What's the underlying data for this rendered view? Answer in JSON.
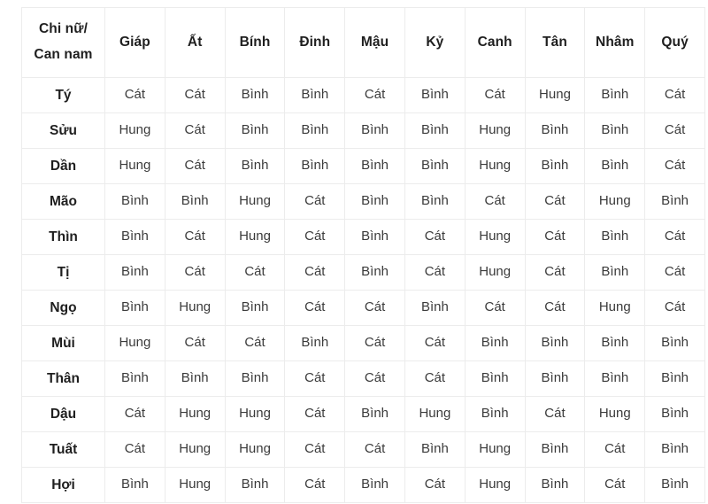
{
  "table": {
    "corner_header": "Chi nữ/ Can nam",
    "column_headers": [
      "Giáp",
      "Ất",
      "Bính",
      "Đinh",
      "Mậu",
      "Kỷ",
      "Canh",
      "Tân",
      "Nhâm",
      "Quý"
    ],
    "row_headers": [
      "Tý",
      "Sửu",
      "Dần",
      "Mão",
      "Thìn",
      "Tị",
      "Ngọ",
      "Mùi",
      "Thân",
      "Dậu",
      "Tuất",
      "Hợi"
    ],
    "rows": [
      {
        "label": "Tý",
        "cells": [
          "Cát",
          "Cát",
          "Bình",
          "Bình",
          "Cát",
          "Bình",
          "Cát",
          "Hung",
          "Bình",
          "Cát"
        ]
      },
      {
        "label": "Sửu",
        "cells": [
          "Hung",
          "Cát",
          "Bình",
          "Bình",
          "Bình",
          "Bình",
          "Hung",
          "Bình",
          "Bình",
          "Cát"
        ]
      },
      {
        "label": "Dần",
        "cells": [
          "Hung",
          "Cát",
          "Bình",
          "Bình",
          "Bình",
          "Bình",
          "Hung",
          "Bình",
          "Bình",
          "Cát"
        ]
      },
      {
        "label": "Mão",
        "cells": [
          "Bình",
          "Bình",
          "Hung",
          "Cát",
          "Bình",
          "Bình",
          "Cát",
          "Cát",
          "Hung",
          "Bình"
        ]
      },
      {
        "label": "Thìn",
        "cells": [
          "Bình",
          "Cát",
          "Hung",
          "Cát",
          "Bình",
          "Cát",
          "Hung",
          "Cát",
          "Bình",
          "Cát"
        ]
      },
      {
        "label": "Tị",
        "cells": [
          "Bình",
          "Cát",
          "Cát",
          "Cát",
          "Bình",
          "Cát",
          "Hung",
          "Cát",
          "Bình",
          "Cát"
        ]
      },
      {
        "label": "Ngọ",
        "cells": [
          "Bình",
          "Hung",
          "Bình",
          "Cát",
          "Cát",
          "Bình",
          "Cát",
          "Cát",
          "Hung",
          "Cát"
        ]
      },
      {
        "label": "Mùi",
        "cells": [
          "Hung",
          "Cát",
          "Cát",
          "Bình",
          "Cát",
          "Cát",
          "Bình",
          "Bình",
          "Bình",
          "Bình"
        ]
      },
      {
        "label": "Thân",
        "cells": [
          "Bình",
          "Bình",
          "Bình",
          "Cát",
          "Cát",
          "Cát",
          "Bình",
          "Bình",
          "Bình",
          "Bình"
        ]
      },
      {
        "label": "Dậu",
        "cells": [
          "Cát",
          "Hung",
          "Hung",
          "Cát",
          "Bình",
          "Hung",
          "Bình",
          "Cát",
          "Hung",
          "Bình"
        ]
      },
      {
        "label": "Tuất",
        "cells": [
          "Cát",
          "Hung",
          "Hung",
          "Cát",
          "Cát",
          "Bình",
          "Hung",
          "Bình",
          "Cát",
          "Bình"
        ]
      },
      {
        "label": "Hợi",
        "cells": [
          "Bình",
          "Hung",
          "Bình",
          "Cát",
          "Bình",
          "Cát",
          "Hung",
          "Bình",
          "Cát",
          "Bình"
        ]
      }
    ]
  },
  "colors": {
    "border": "#ececec",
    "header_text": "#1f1f1f",
    "cell_text": "#3b3b3b",
    "background": "#ffffff"
  }
}
